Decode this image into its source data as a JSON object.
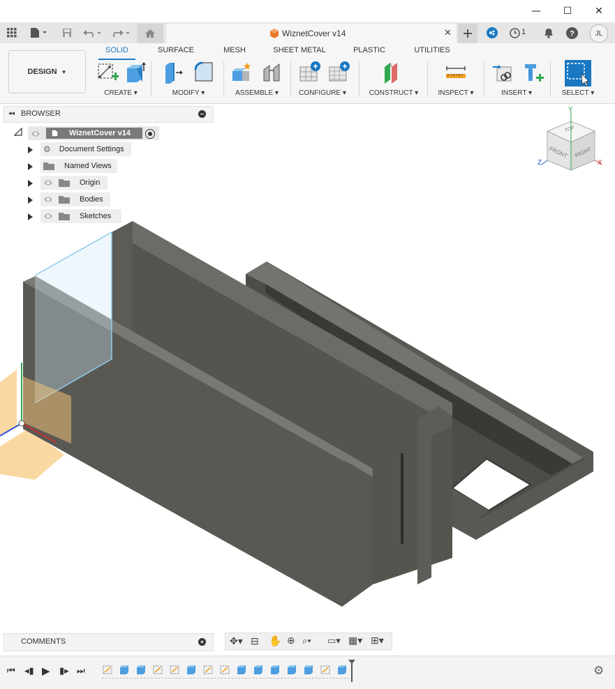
{
  "window": {
    "minimize": "—",
    "maximize": "☐",
    "close": "✕"
  },
  "tabbar": {
    "doc_title": "WiznetCover v14",
    "notifications_count": "1",
    "user_initials": "JL"
  },
  "ribbon": {
    "workspace": "DESIGN",
    "tabs": [
      "SOLID",
      "SURFACE",
      "MESH",
      "SHEET METAL",
      "PLASTIC",
      "UTILITIES"
    ],
    "active_tab": "SOLID",
    "groups": [
      "CREATE",
      "MODIFY",
      "ASSEMBLE",
      "CONFIGURE",
      "CONSTRUCT",
      "INSPECT",
      "INSERT",
      "SELECT"
    ]
  },
  "browser": {
    "title": "BROWSER",
    "root": "WiznetCover v14",
    "items": [
      "Document Settings",
      "Named Views",
      "Origin",
      "Bodies",
      "Sketches"
    ]
  },
  "viewcube": {
    "top": "TOP",
    "front": "FRONT",
    "right": "RIGHT",
    "axis_x": "X",
    "axis_y": "Y",
    "axis_z": "Z"
  },
  "comments": {
    "title": "COMMENTS"
  },
  "colors": {
    "accent": "#1a78c2",
    "body": "#5a5853",
    "sketch_plane": "#f7c77a",
    "highlight": "#7fc4e8"
  }
}
